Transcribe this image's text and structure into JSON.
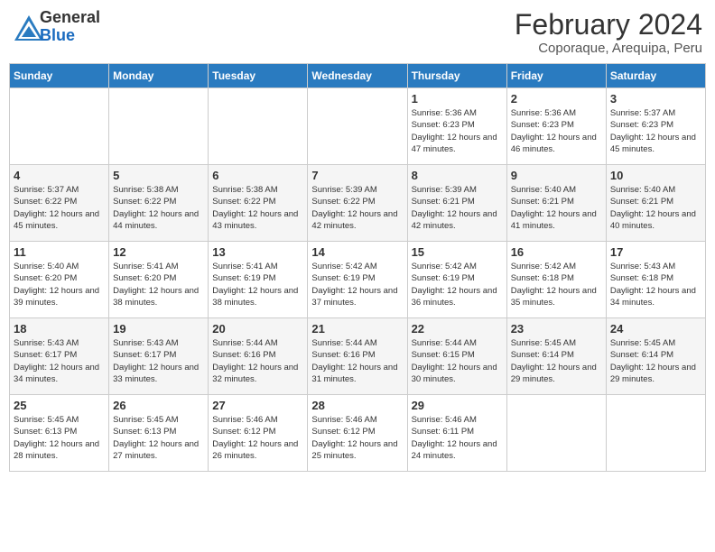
{
  "header": {
    "logo_general": "General",
    "logo_blue": "Blue",
    "month_title": "February 2024",
    "subtitle": "Coporaque, Arequipa, Peru"
  },
  "days_of_week": [
    "Sunday",
    "Monday",
    "Tuesday",
    "Wednesday",
    "Thursday",
    "Friday",
    "Saturday"
  ],
  "weeks": [
    [
      {
        "day": "",
        "info": ""
      },
      {
        "day": "",
        "info": ""
      },
      {
        "day": "",
        "info": ""
      },
      {
        "day": "",
        "info": ""
      },
      {
        "day": "1",
        "info": "Sunrise: 5:36 AM\nSunset: 6:23 PM\nDaylight: 12 hours\nand 47 minutes."
      },
      {
        "day": "2",
        "info": "Sunrise: 5:36 AM\nSunset: 6:23 PM\nDaylight: 12 hours\nand 46 minutes."
      },
      {
        "day": "3",
        "info": "Sunrise: 5:37 AM\nSunset: 6:23 PM\nDaylight: 12 hours\nand 45 minutes."
      }
    ],
    [
      {
        "day": "4",
        "info": "Sunrise: 5:37 AM\nSunset: 6:22 PM\nDaylight: 12 hours\nand 45 minutes."
      },
      {
        "day": "5",
        "info": "Sunrise: 5:38 AM\nSunset: 6:22 PM\nDaylight: 12 hours\nand 44 minutes."
      },
      {
        "day": "6",
        "info": "Sunrise: 5:38 AM\nSunset: 6:22 PM\nDaylight: 12 hours\nand 43 minutes."
      },
      {
        "day": "7",
        "info": "Sunrise: 5:39 AM\nSunset: 6:22 PM\nDaylight: 12 hours\nand 42 minutes."
      },
      {
        "day": "8",
        "info": "Sunrise: 5:39 AM\nSunset: 6:21 PM\nDaylight: 12 hours\nand 42 minutes."
      },
      {
        "day": "9",
        "info": "Sunrise: 5:40 AM\nSunset: 6:21 PM\nDaylight: 12 hours\nand 41 minutes."
      },
      {
        "day": "10",
        "info": "Sunrise: 5:40 AM\nSunset: 6:21 PM\nDaylight: 12 hours\nand 40 minutes."
      }
    ],
    [
      {
        "day": "11",
        "info": "Sunrise: 5:40 AM\nSunset: 6:20 PM\nDaylight: 12 hours\nand 39 minutes."
      },
      {
        "day": "12",
        "info": "Sunrise: 5:41 AM\nSunset: 6:20 PM\nDaylight: 12 hours\nand 38 minutes."
      },
      {
        "day": "13",
        "info": "Sunrise: 5:41 AM\nSunset: 6:19 PM\nDaylight: 12 hours\nand 38 minutes."
      },
      {
        "day": "14",
        "info": "Sunrise: 5:42 AM\nSunset: 6:19 PM\nDaylight: 12 hours\nand 37 minutes."
      },
      {
        "day": "15",
        "info": "Sunrise: 5:42 AM\nSunset: 6:19 PM\nDaylight: 12 hours\nand 36 minutes."
      },
      {
        "day": "16",
        "info": "Sunrise: 5:42 AM\nSunset: 6:18 PM\nDaylight: 12 hours\nand 35 minutes."
      },
      {
        "day": "17",
        "info": "Sunrise: 5:43 AM\nSunset: 6:18 PM\nDaylight: 12 hours\nand 34 minutes."
      }
    ],
    [
      {
        "day": "18",
        "info": "Sunrise: 5:43 AM\nSunset: 6:17 PM\nDaylight: 12 hours\nand 34 minutes."
      },
      {
        "day": "19",
        "info": "Sunrise: 5:43 AM\nSunset: 6:17 PM\nDaylight: 12 hours\nand 33 minutes."
      },
      {
        "day": "20",
        "info": "Sunrise: 5:44 AM\nSunset: 6:16 PM\nDaylight: 12 hours\nand 32 minutes."
      },
      {
        "day": "21",
        "info": "Sunrise: 5:44 AM\nSunset: 6:16 PM\nDaylight: 12 hours\nand 31 minutes."
      },
      {
        "day": "22",
        "info": "Sunrise: 5:44 AM\nSunset: 6:15 PM\nDaylight: 12 hours\nand 30 minutes."
      },
      {
        "day": "23",
        "info": "Sunrise: 5:45 AM\nSunset: 6:14 PM\nDaylight: 12 hours\nand 29 minutes."
      },
      {
        "day": "24",
        "info": "Sunrise: 5:45 AM\nSunset: 6:14 PM\nDaylight: 12 hours\nand 29 minutes."
      }
    ],
    [
      {
        "day": "25",
        "info": "Sunrise: 5:45 AM\nSunset: 6:13 PM\nDaylight: 12 hours\nand 28 minutes."
      },
      {
        "day": "26",
        "info": "Sunrise: 5:45 AM\nSunset: 6:13 PM\nDaylight: 12 hours\nand 27 minutes."
      },
      {
        "day": "27",
        "info": "Sunrise: 5:46 AM\nSunset: 6:12 PM\nDaylight: 12 hours\nand 26 minutes."
      },
      {
        "day": "28",
        "info": "Sunrise: 5:46 AM\nSunset: 6:12 PM\nDaylight: 12 hours\nand 25 minutes."
      },
      {
        "day": "29",
        "info": "Sunrise: 5:46 AM\nSunset: 6:11 PM\nDaylight: 12 hours\nand 24 minutes."
      },
      {
        "day": "",
        "info": ""
      },
      {
        "day": "",
        "info": ""
      }
    ]
  ]
}
